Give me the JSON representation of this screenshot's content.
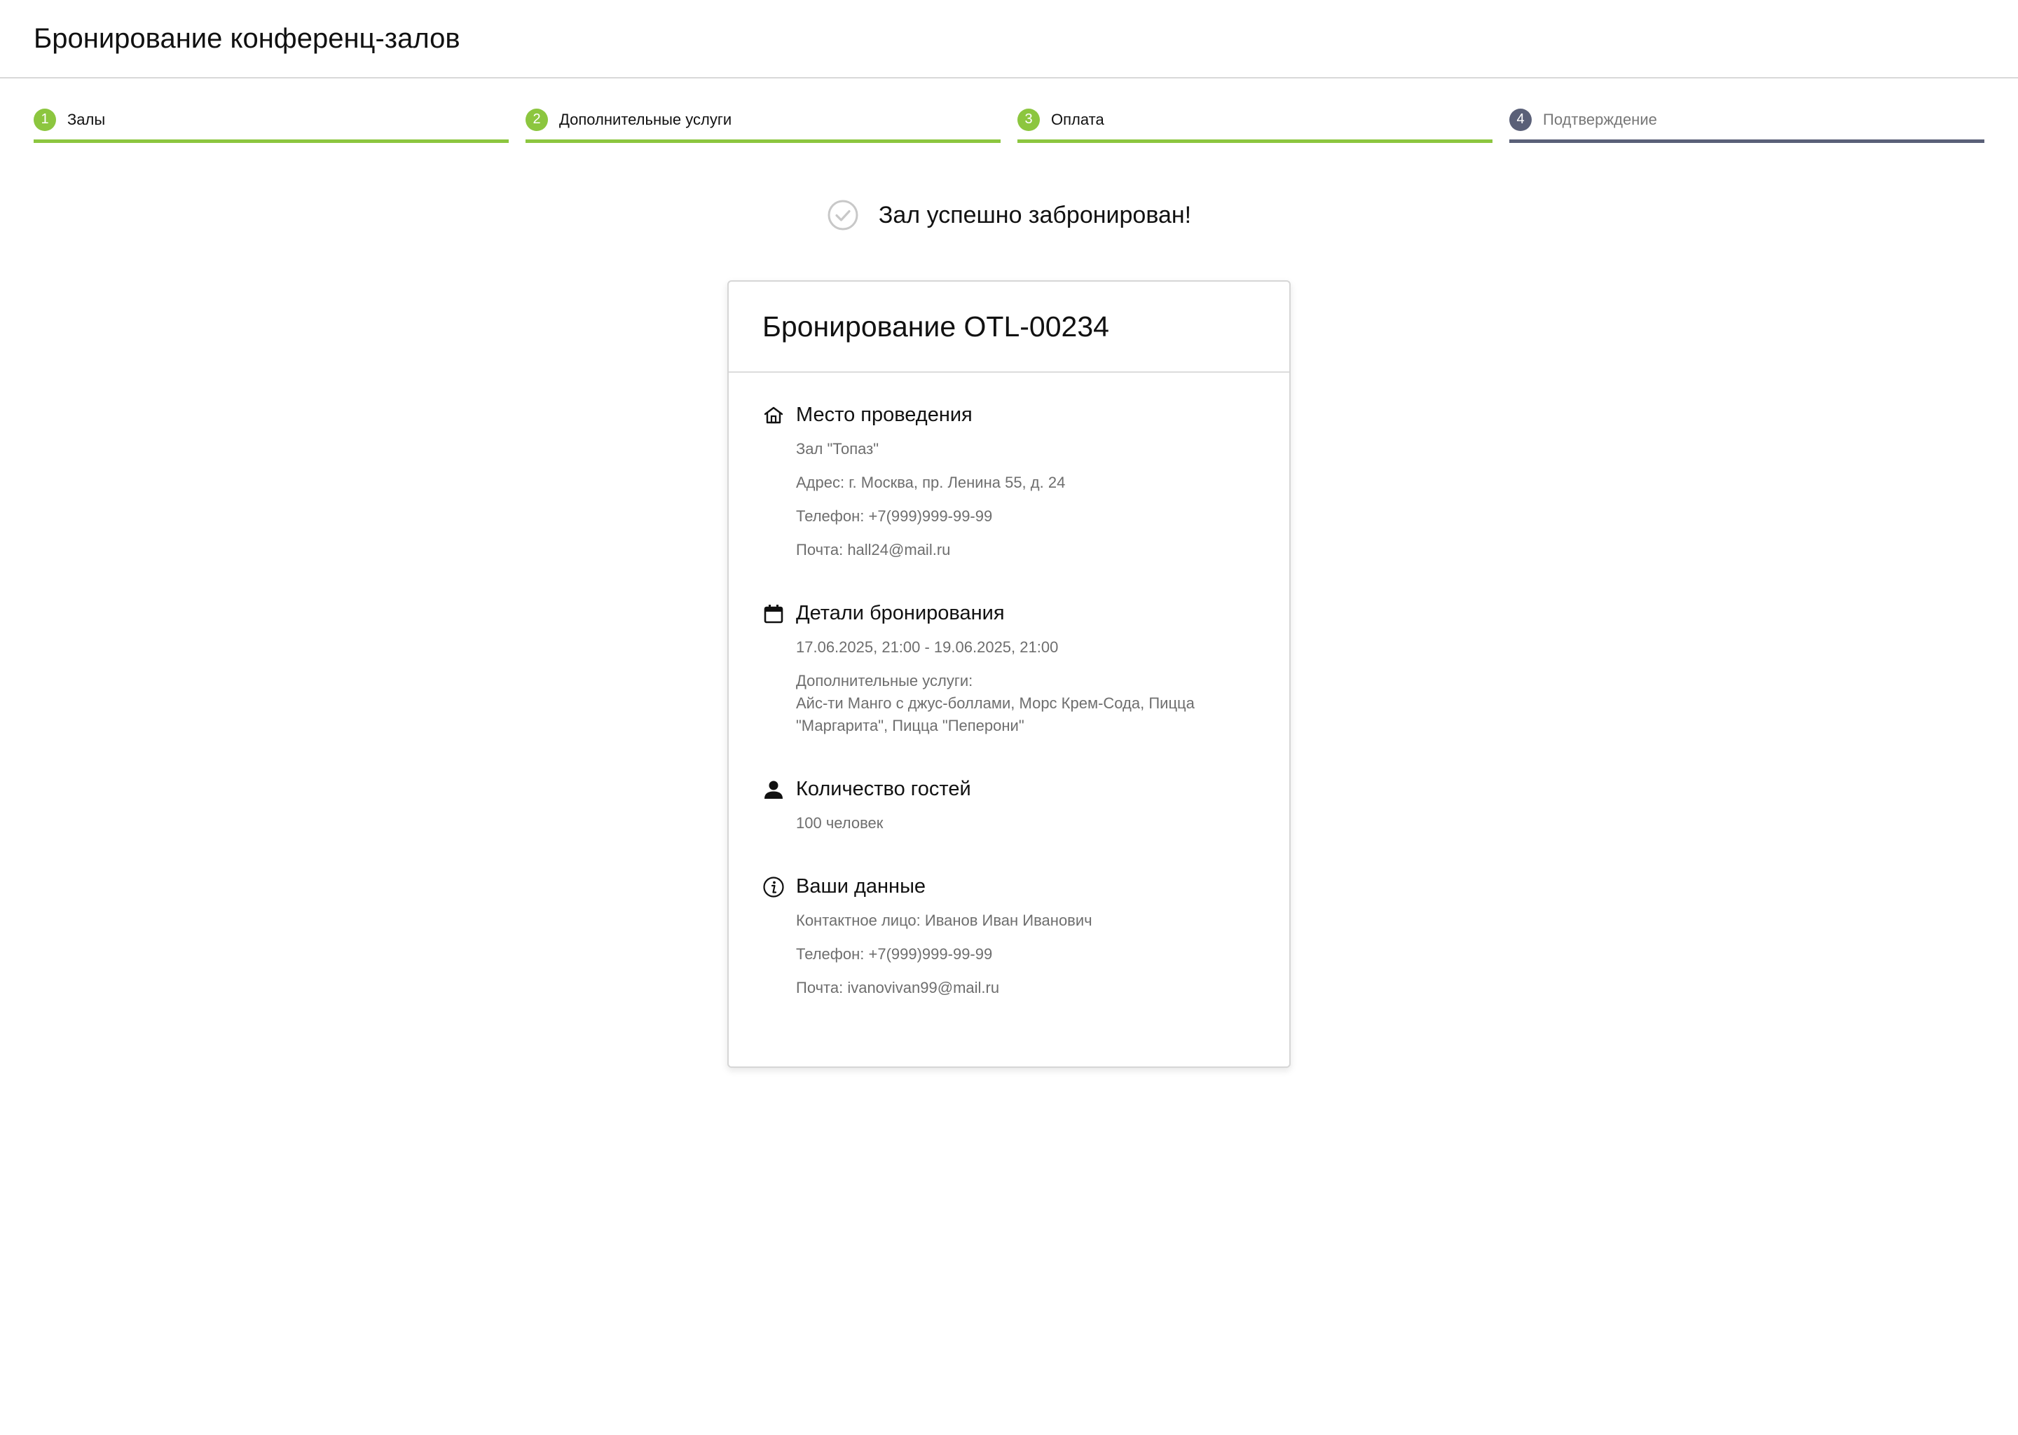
{
  "app": {
    "title": "Бронирование конференц-залов"
  },
  "stepper": {
    "steps": [
      {
        "number": "1",
        "label": "Залы",
        "state": "done"
      },
      {
        "number": "2",
        "label": "Дополнительные услуги",
        "state": "done"
      },
      {
        "number": "3",
        "label": "Оплата",
        "state": "done"
      },
      {
        "number": "4",
        "label": "Подтверждение",
        "state": "current"
      }
    ],
    "colors": {
      "done": "#8cc63f",
      "current": "#5a6078"
    }
  },
  "success": {
    "icon": "check-circle-icon",
    "message": "Зал успешно забронирован!"
  },
  "booking": {
    "title": "Бронирование OTL-00234",
    "venue": {
      "icon": "home-icon",
      "heading": "Место проведения",
      "hall": "Зал \"Топаз\"",
      "address": "Адрес: г. Москва, пр. Ленина 55, д. 24",
      "phone": "Телефон: +7(999)999-99-99",
      "email": "Почта: hall24@mail.ru"
    },
    "details": {
      "icon": "calendar-icon",
      "heading": "Детали бронирования",
      "dates": "17.06.2025, 21:00 - 19.06.2025, 21:00",
      "services_label": "Дополнительные услуги:",
      "services": "Айс-ти Манго с джус-боллами, Морс Крем-Сода, Пицца \"Маргарита\", Пицца \"Пеперони\""
    },
    "guests": {
      "icon": "person-icon",
      "heading": "Количество гостей",
      "count": "100 человек"
    },
    "contact": {
      "icon": "info-icon",
      "heading": "Ваши данные",
      "person": "Контактное лицо: Иванов Иван Иванович",
      "phone": "Телефон: +7(999)999-99-99",
      "email": "Почта: ivanovivan99@mail.ru"
    }
  }
}
